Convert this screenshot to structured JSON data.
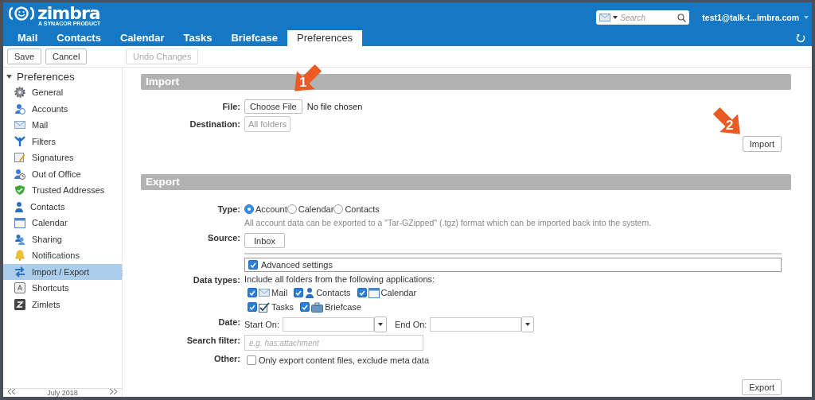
{
  "logo": {
    "name": "zimbra",
    "tagline": "A SYNACOR PRODUCT"
  },
  "search": {
    "placeholder": "Search"
  },
  "account": "test1@talk-t...imbra.com",
  "tabs": [
    {
      "label": "Mail",
      "selected": false
    },
    {
      "label": "Contacts",
      "selected": false
    },
    {
      "label": "Calendar",
      "selected": false
    },
    {
      "label": "Tasks",
      "selected": false
    },
    {
      "label": "Briefcase",
      "selected": false
    },
    {
      "label": "Preferences",
      "selected": true
    }
  ],
  "toolbar": [
    {
      "label": "Save",
      "disabled": false
    },
    {
      "label": "Cancel",
      "disabled": false
    },
    {
      "label": "Undo Changes",
      "disabled": true
    }
  ],
  "sidebar": {
    "title": "Preferences",
    "expanded": true,
    "items": [
      {
        "label": "General",
        "selected": false
      },
      {
        "label": "Accounts",
        "selected": false
      },
      {
        "label": "Mail",
        "selected": false
      },
      {
        "label": "Filters",
        "selected": false
      },
      {
        "label": "Signatures",
        "selected": false
      },
      {
        "label": "Out of Office",
        "selected": false
      },
      {
        "label": "Trusted Addresses",
        "selected": false
      },
      {
        "label": "Contacts",
        "selected": false
      },
      {
        "label": "Calendar",
        "selected": false
      },
      {
        "label": "Sharing",
        "selected": false
      },
      {
        "label": "Notifications",
        "selected": false
      },
      {
        "label": "Import / Export",
        "selected": true
      },
      {
        "label": "Shortcuts",
        "selected": false
      },
      {
        "label": "Zimlets",
        "selected": false
      }
    ]
  },
  "mini_calendar": {
    "title": "July 2018"
  },
  "import": {
    "title": "Import",
    "file_label": "File:",
    "choose_button": "Choose File",
    "file_status": "No file chosen",
    "destination_label": "Destination:",
    "destination": "All folders",
    "button": "Import"
  },
  "export": {
    "title": "Export",
    "type_label": "Type:",
    "types": [
      {
        "label": "Account",
        "selected": true
      },
      {
        "label": "Calendar",
        "selected": false
      },
      {
        "label": "Contacts",
        "selected": false
      }
    ],
    "description": "All account data can be exported to a \"Tar-GZipped\" (.tgz) format which can be imported back into the system.",
    "source_label": "Source:",
    "source": "Inbox",
    "advanced": {
      "label": "Advanced settings",
      "checked": true
    },
    "data_types_label": "Data types:",
    "data_types_intro": "Include all folders from the following applications:",
    "data_types": [
      {
        "label": "Mail",
        "checked": true
      },
      {
        "label": "Contacts",
        "checked": true
      },
      {
        "label": "Calendar",
        "checked": true
      },
      {
        "label": "Tasks",
        "checked": true
      },
      {
        "label": "Briefcase",
        "checked": true
      }
    ],
    "date_label": "Date:",
    "start_label": "Start On:",
    "end_label": "End On:",
    "filter_label": "Search filter:",
    "filter_placeholder": "e.g. has:attachment",
    "other_label": "Other:",
    "other": {
      "label": "Only export content files, exclude meta data",
      "checked": false
    },
    "button": "Export"
  },
  "annotations": [
    {
      "number": "1"
    },
    {
      "number": "2"
    }
  ]
}
